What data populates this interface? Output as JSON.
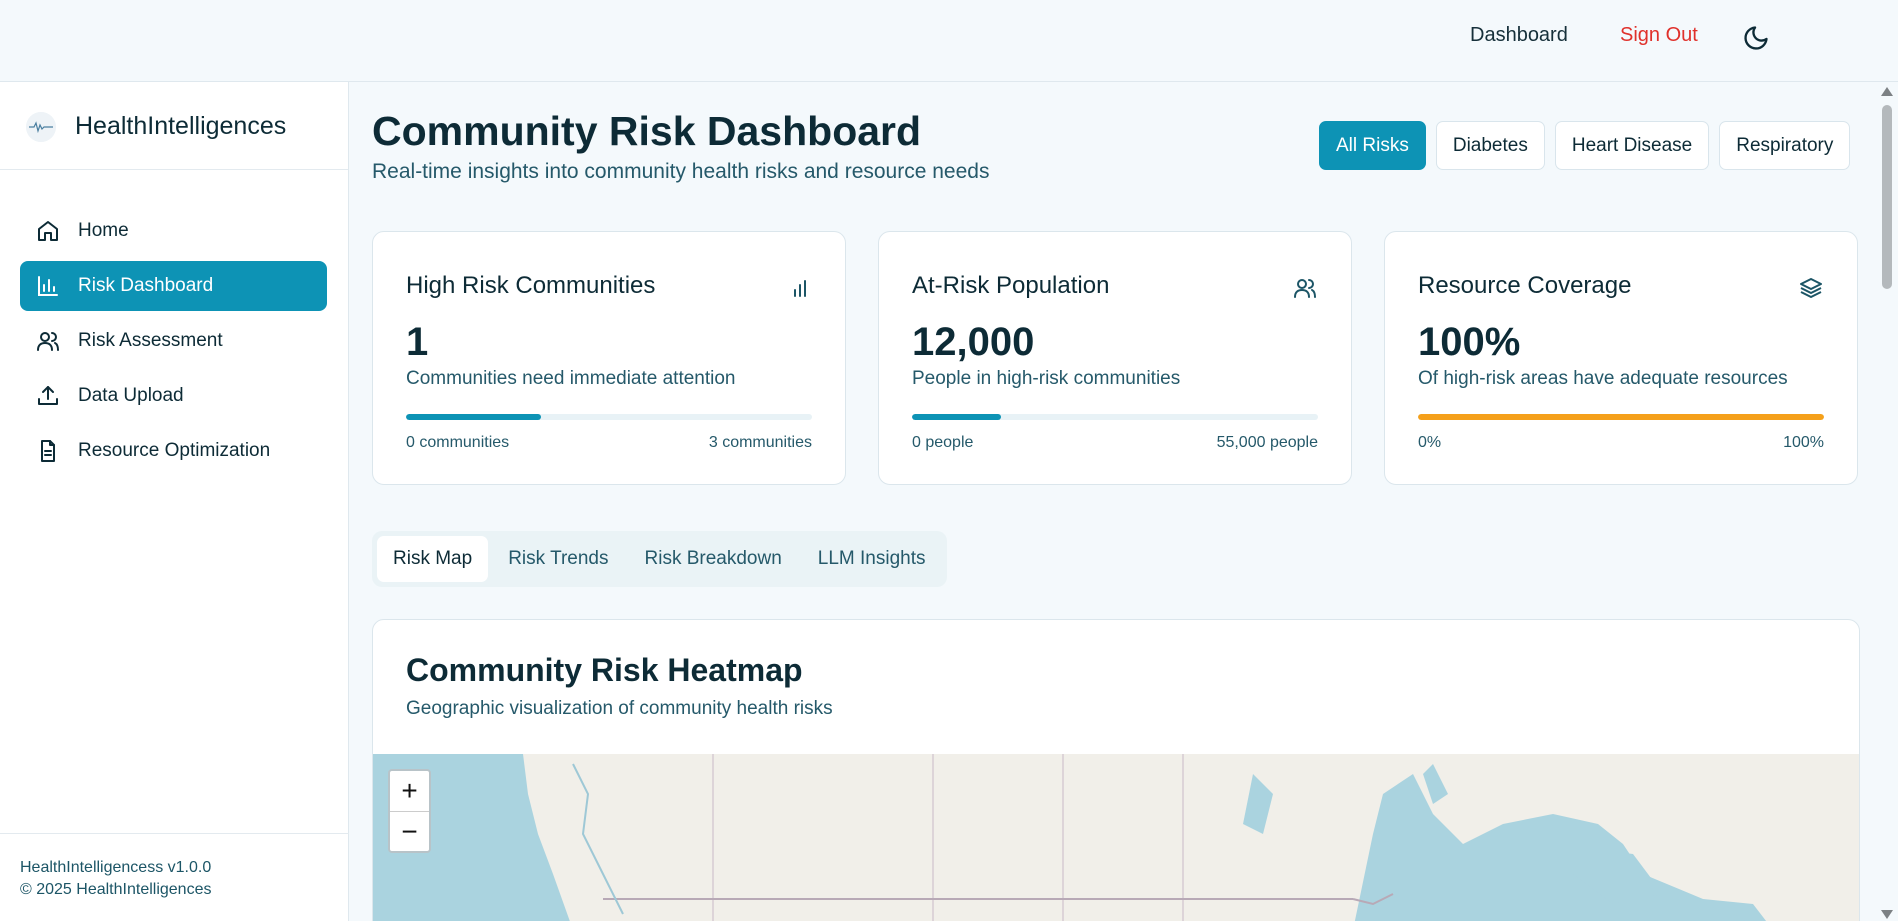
{
  "topbar": {
    "dashboard_label": "Dashboard",
    "signout_label": "Sign Out",
    "theme_icon": "moon-icon"
  },
  "sidebar": {
    "brand_name": "HealthIntelligences",
    "items": [
      {
        "label": "Home",
        "icon": "home-icon",
        "active": false
      },
      {
        "label": "Risk Dashboard",
        "icon": "bar-chart-icon",
        "active": true
      },
      {
        "label": "Risk Assessment",
        "icon": "users-icon",
        "active": false
      },
      {
        "label": "Data Upload",
        "icon": "upload-icon",
        "active": false
      },
      {
        "label": "Resource Optimization",
        "icon": "file-text-icon",
        "active": false
      }
    ],
    "version": "HealthIntelligencess v1.0.0",
    "copyright": "© 2025 HealthIntelligences"
  },
  "header": {
    "title": "Community Risk Dashboard",
    "subtitle": "Real-time insights into community health risks and resource needs"
  },
  "filters": [
    {
      "label": "All Risks",
      "active": true
    },
    {
      "label": "Diabetes",
      "active": false
    },
    {
      "label": "Heart Disease",
      "active": false
    },
    {
      "label": "Respiratory",
      "active": false
    }
  ],
  "cards": [
    {
      "title": "High Risk Communities",
      "icon": "bar-chart-icon",
      "value": "1",
      "description": "Communities need immediate attention",
      "progress": 0.333,
      "bar_color": "#0d93b5",
      "min_label": "0 communities",
      "max_label": "3 communities"
    },
    {
      "title": "At-Risk Population",
      "icon": "users-icon",
      "value": "12,000",
      "description": "People in high-risk communities",
      "progress": 0.218,
      "bar_color": "#0d93b5",
      "min_label": "0 people",
      "max_label": "55,000 people"
    },
    {
      "title": "Resource Coverage",
      "icon": "layers-icon",
      "value": "100%",
      "description": "Of high-risk areas have adequate resources",
      "progress": 1.0,
      "bar_color": "#f5a01a",
      "min_label": "0%",
      "max_label": "100%"
    }
  ],
  "tabs": [
    {
      "label": "Risk Map",
      "active": true
    },
    {
      "label": "Risk Trends",
      "active": false
    },
    {
      "label": "Risk Breakdown",
      "active": false
    },
    {
      "label": "LLM Insights",
      "active": false
    }
  ],
  "map": {
    "title": "Community Risk Heatmap",
    "subtitle": "Geographic visualization of community health risks",
    "zoom_in": "+",
    "zoom_out": "−"
  }
}
